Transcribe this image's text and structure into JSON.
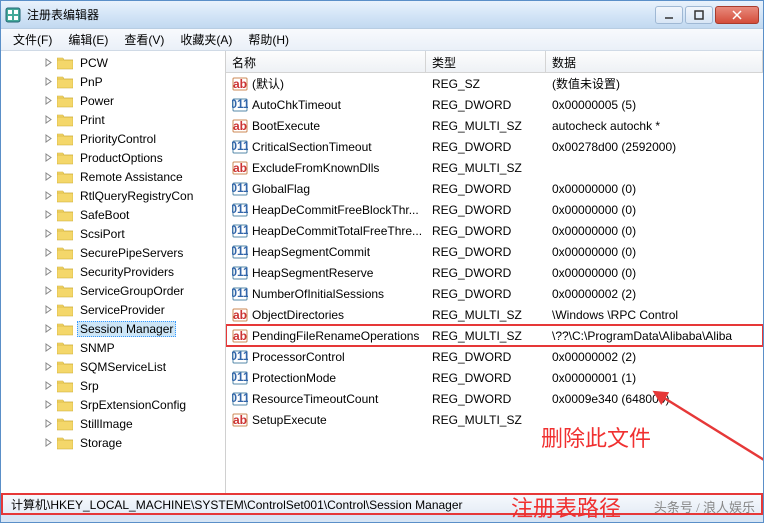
{
  "window": {
    "title": "注册表编辑器"
  },
  "menubar": {
    "file": "文件(F)",
    "edit": "编辑(E)",
    "view": "查看(V)",
    "favorites": "收藏夹(A)",
    "help": "帮助(H)"
  },
  "tree": {
    "items": [
      {
        "label": "PCW",
        "expanded": false
      },
      {
        "label": "PnP",
        "expanded": false
      },
      {
        "label": "Power",
        "expanded": false
      },
      {
        "label": "Print",
        "expanded": false
      },
      {
        "label": "PriorityControl",
        "expanded": false
      },
      {
        "label": "ProductOptions",
        "expanded": false
      },
      {
        "label": "Remote Assistance",
        "expanded": false
      },
      {
        "label": "RtlQueryRegistryCon",
        "expanded": false
      },
      {
        "label": "SafeBoot",
        "expanded": false
      },
      {
        "label": "ScsiPort",
        "expanded": false
      },
      {
        "label": "SecurePipeServers",
        "expanded": false
      },
      {
        "label": "SecurityProviders",
        "expanded": false
      },
      {
        "label": "ServiceGroupOrder",
        "expanded": false
      },
      {
        "label": "ServiceProvider",
        "expanded": false
      },
      {
        "label": "Session Manager",
        "selected": true,
        "expanded": false
      },
      {
        "label": "SNMP",
        "expanded": false
      },
      {
        "label": "SQMServiceList",
        "expanded": false
      },
      {
        "label": "Srp",
        "expanded": false
      },
      {
        "label": "SrpExtensionConfig",
        "expanded": false
      },
      {
        "label": "StillImage",
        "expanded": false
      },
      {
        "label": "Storage",
        "expanded": false
      }
    ]
  },
  "list": {
    "headers": {
      "name": "名称",
      "type": "类型",
      "data": "数据"
    },
    "rows": [
      {
        "icon": "string",
        "name": "(默认)",
        "type": "REG_SZ",
        "data": "(数值未设置)",
        "default": true
      },
      {
        "icon": "binary",
        "name": "AutoChkTimeout",
        "type": "REG_DWORD",
        "data": "0x00000005 (5)"
      },
      {
        "icon": "string",
        "name": "BootExecute",
        "type": "REG_MULTI_SZ",
        "data": "autocheck autochk *"
      },
      {
        "icon": "binary",
        "name": "CriticalSectionTimeout",
        "type": "REG_DWORD",
        "data": "0x00278d00 (2592000)"
      },
      {
        "icon": "string",
        "name": "ExcludeFromKnownDlls",
        "type": "REG_MULTI_SZ",
        "data": ""
      },
      {
        "icon": "binary",
        "name": "GlobalFlag",
        "type": "REG_DWORD",
        "data": "0x00000000 (0)"
      },
      {
        "icon": "binary",
        "name": "HeapDeCommitFreeBlockThr...",
        "type": "REG_DWORD",
        "data": "0x00000000 (0)"
      },
      {
        "icon": "binary",
        "name": "HeapDeCommitTotalFreeThre...",
        "type": "REG_DWORD",
        "data": "0x00000000 (0)"
      },
      {
        "icon": "binary",
        "name": "HeapSegmentCommit",
        "type": "REG_DWORD",
        "data": "0x00000000 (0)"
      },
      {
        "icon": "binary",
        "name": "HeapSegmentReserve",
        "type": "REG_DWORD",
        "data": "0x00000000 (0)"
      },
      {
        "icon": "binary",
        "name": "NumberOfInitialSessions",
        "type": "REG_DWORD",
        "data": "0x00000002 (2)"
      },
      {
        "icon": "string",
        "name": "ObjectDirectories",
        "type": "REG_MULTI_SZ",
        "data": "\\Windows \\RPC Control"
      },
      {
        "icon": "string",
        "name": "PendingFileRenameOperations",
        "type": "REG_MULTI_SZ",
        "data": "\\??\\C:\\ProgramData\\Alibaba\\Aliba",
        "highlighted": true
      },
      {
        "icon": "binary",
        "name": "ProcessorControl",
        "type": "REG_DWORD",
        "data": "0x00000002 (2)"
      },
      {
        "icon": "binary",
        "name": "ProtectionMode",
        "type": "REG_DWORD",
        "data": "0x00000001 (1)"
      },
      {
        "icon": "binary",
        "name": "ResourceTimeoutCount",
        "type": "REG_DWORD",
        "data": "0x0009e340 (648000)"
      },
      {
        "icon": "string",
        "name": "SetupExecute",
        "type": "REG_MULTI_SZ",
        "data": ""
      }
    ]
  },
  "statusbar": {
    "path": "计算机\\HKEY_LOCAL_MACHINE\\SYSTEM\\ControlSet001\\Control\\Session Manager"
  },
  "annotations": {
    "delete_file": "删除此文件",
    "registry_path": "注册表路径",
    "watermark": "头条号 / 浪人娱乐"
  }
}
